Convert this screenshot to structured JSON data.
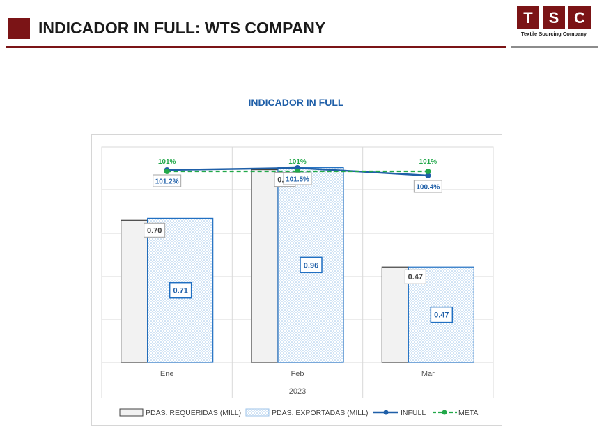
{
  "header": {
    "title": "INDICADOR IN FULL: WTS COMPANY",
    "logo_letters": [
      "T",
      "S",
      "C"
    ],
    "logo_caption": "Textile Sourcing Company",
    "brand_color": "#7b1416"
  },
  "chart_data": {
    "type": "bar",
    "title": "INDICADOR IN FULL",
    "categories": [
      "Ene",
      "Feb",
      "Mar"
    ],
    "group_label": "2023",
    "series": [
      {
        "name": "PDAS. REQUERIDAS (MILL)",
        "kind": "bar",
        "values": [
          0.7,
          0.95,
          0.47
        ],
        "labels": [
          "0.70",
          "0.95",
          "0.47"
        ],
        "color": "#f2f2f2"
      },
      {
        "name": "PDAS. EXPORTADAS (MILL)",
        "kind": "bar",
        "values": [
          0.71,
          0.96,
          0.47
        ],
        "labels": [
          "0.71",
          "0.96",
          "0.47"
        ],
        "color": "#1f6fc2"
      },
      {
        "name": "INFULL",
        "kind": "line",
        "values": [
          101.2,
          101.5,
          100.4
        ],
        "labels": [
          "101.2%",
          "101.5%",
          "100.4%"
        ],
        "color": "#1f5fa8"
      },
      {
        "name": "META",
        "kind": "line",
        "values": [
          101,
          101,
          101
        ],
        "labels": [
          "101%",
          "101%",
          "101%"
        ],
        "color": "#22a84a",
        "dashed": true
      }
    ],
    "grid": true,
    "legend_position": "bottom"
  }
}
